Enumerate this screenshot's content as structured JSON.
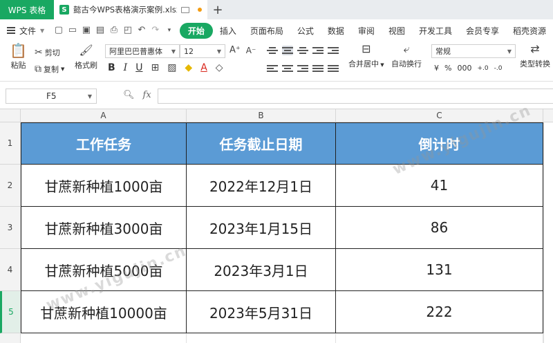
{
  "tabs": {
    "app_label": "WPS 表格",
    "doc_name": "懿古今WPS表格演示案例.xlsx",
    "new_tab": "+"
  },
  "menu": {
    "file": "文件",
    "items": [
      "开始",
      "插入",
      "页面布局",
      "公式",
      "数据",
      "审阅",
      "视图",
      "开发工具",
      "会员专享",
      "稻壳资源"
    ]
  },
  "ribbon": {
    "paste": "粘贴",
    "cut": "剪切",
    "copy": "复制",
    "format_painter": "格式刷",
    "font_name": "阿里巴巴普惠体",
    "font_size": "12",
    "merge_center": "合并居中",
    "wrap_text": "自动换行",
    "number_format": "常规",
    "type_convert": "类型转换",
    "bold": "B",
    "italic": "I",
    "underline": "U",
    "currency": "¥",
    "percent": "%",
    "thousands": "000",
    "dec_inc": "+.0",
    "dec_dec": "-.0"
  },
  "formula_bar": {
    "name_box": "F5",
    "fx": "fx",
    "content": ""
  },
  "columns": [
    "A",
    "B",
    "C"
  ],
  "rows": [
    "1",
    "2",
    "3",
    "4",
    "5"
  ],
  "table": {
    "headers": [
      "工作任务",
      "任务截止日期",
      "倒计时"
    ],
    "data": [
      [
        "甘蔗新种植1000亩",
        "2022年12月1日",
        "41"
      ],
      [
        "甘蔗新种植3000亩",
        "2023年1月15日",
        "86"
      ],
      [
        "甘蔗新种植5000亩",
        "2023年3月1日",
        "131"
      ],
      [
        "甘蔗新种植10000亩",
        "2023年5月31日",
        "222"
      ]
    ]
  },
  "watermark": "www.yigujin.cn",
  "colors": {
    "accent": "#19a862",
    "header_fill": "#5b9bd5"
  }
}
